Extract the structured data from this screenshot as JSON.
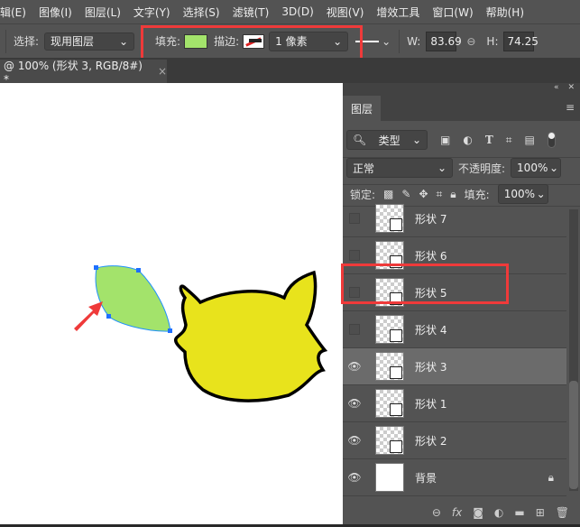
{
  "menu": [
    "辑(E)",
    "图像(I)",
    "图层(L)",
    "文字(Y)",
    "选择(S)",
    "滤镜(T)",
    "3D(D)",
    "视图(V)",
    "增效工具",
    "窗口(W)",
    "帮助(H)"
  ],
  "options": {
    "select_label": "选择:",
    "select_value": "现用图层",
    "fill_label": "填充:",
    "fill_color": "#a3e36b",
    "stroke_label": "描边:",
    "stroke_width": "1 像素",
    "w_label": "W:",
    "w_value": "83.69",
    "h_label": "H:",
    "h_value": "74.25"
  },
  "doc_tab": {
    "title": "@ 100% (形状 3, RGB/8#) *",
    "close": "×"
  },
  "panel": {
    "tab": "图层",
    "filter_value": "类型",
    "blend_mode": "正常",
    "opacity_label": "不透明度:",
    "opacity_value": "100%",
    "lock_label": "锁定:",
    "fill_label": "填充:",
    "fill_value": "100%",
    "layers": [
      {
        "name": "形状 7",
        "visible": false,
        "selected": false
      },
      {
        "name": "形状 6",
        "visible": false,
        "selected": false
      },
      {
        "name": "形状 5",
        "visible": false,
        "selected": false
      },
      {
        "name": "形状 4",
        "visible": false,
        "selected": false
      },
      {
        "name": "形状 3",
        "visible": true,
        "selected": true
      },
      {
        "name": "形状 1",
        "visible": true,
        "selected": false
      },
      {
        "name": "形状 2",
        "visible": true,
        "selected": false
      },
      {
        "name": "背景",
        "visible": true,
        "selected": false
      }
    ]
  },
  "colors": {
    "accent_red": "#ef3a3a",
    "leaf": "#a3e36b",
    "bird": "#e8e31c"
  }
}
